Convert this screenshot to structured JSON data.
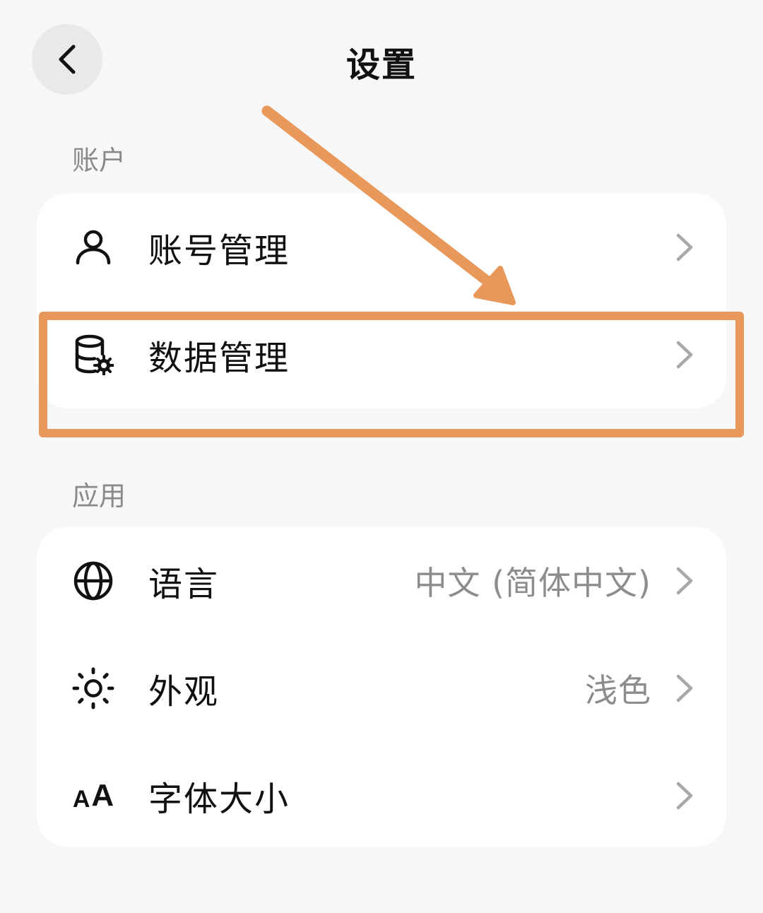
{
  "header": {
    "title": "设置",
    "back_icon": "chevron-left-icon"
  },
  "sections": {
    "account": {
      "label": "账户",
      "items": [
        {
          "label": "账号管理",
          "icon": "user-icon",
          "value": ""
        },
        {
          "label": "数据管理",
          "icon": "database-settings-icon",
          "value": ""
        }
      ]
    },
    "app": {
      "label": "应用",
      "items": [
        {
          "label": "语言",
          "icon": "globe-icon",
          "value": "中文 (简体中文)"
        },
        {
          "label": "外观",
          "icon": "sun-icon",
          "value": "浅色"
        },
        {
          "label": "字体大小",
          "icon": "font-size-icon",
          "value": ""
        }
      ]
    }
  },
  "annotation": {
    "highlighted_item": "数据管理",
    "color": "#e8985a"
  },
  "colors": {
    "background": "#f7f7f7",
    "card": "#ffffff",
    "secondary_text": "#8a8a8a",
    "chevron": "#a8a8a8"
  }
}
